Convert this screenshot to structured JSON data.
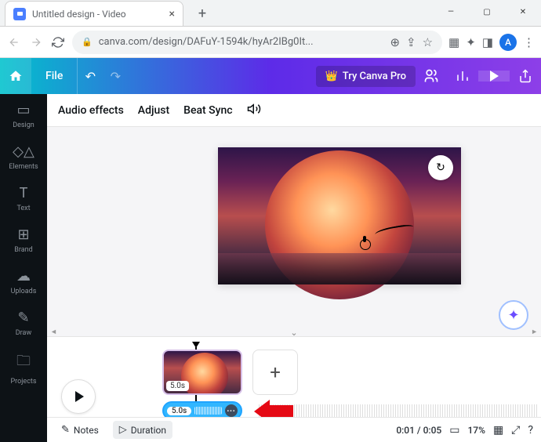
{
  "window": {
    "title": "Untitled design - Video"
  },
  "browser": {
    "url": "canva.com/design/DAFuY-1594k/hyAr2IBg0It...",
    "avatar_letter": "A"
  },
  "header": {
    "file_label": "File",
    "pro_label": "Try Canva Pro"
  },
  "sidenav": {
    "design": "Design",
    "elements": "Elements",
    "text": "Text",
    "brand": "Brand",
    "uploads": "Uploads",
    "draw": "Draw",
    "projects": "Projects"
  },
  "toolbar": {
    "audio_effects": "Audio effects",
    "adjust": "Adjust",
    "beat_sync": "Beat Sync"
  },
  "timeline": {
    "clip_duration": "5.0s",
    "audio_duration": "5.0s",
    "add_label": "+"
  },
  "bottombar": {
    "notes": "Notes",
    "duration": "Duration",
    "time": "0:01 / 0:05",
    "zoom": "17%"
  }
}
